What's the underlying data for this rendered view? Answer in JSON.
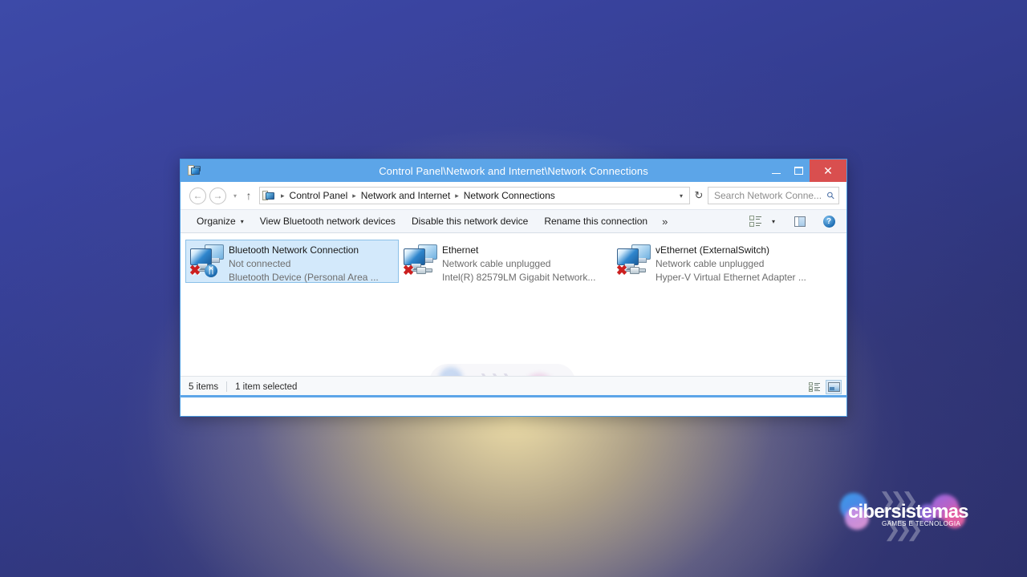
{
  "window": {
    "title": "Control Panel\\Network and Internet\\Network Connections",
    "app_icon": "network-connections-icon",
    "controls": {
      "minimize": "–",
      "maximize": "❑",
      "close": "✕"
    }
  },
  "navbar": {
    "back_icon": "←",
    "forward_icon": "→",
    "recent_caret": "▾",
    "up_icon": "↑",
    "breadcrumb": [
      "Control Panel",
      "Network and Internet",
      "Network Connections"
    ],
    "breadcrumb_separator": "▸",
    "address_caret": "▾",
    "refresh_icon": "↻",
    "search_placeholder": "Search Network Conne...",
    "search_value": "",
    "search_icon": "⚲"
  },
  "toolbar": {
    "organize_label": "Organize",
    "organize_caret": "▾",
    "view_bluetooth_label": "View Bluetooth network devices",
    "disable_device_label": "Disable this network device",
    "rename_connection_label": "Rename this connection",
    "overflow_label": "»",
    "change_view_icon": "change-view-icon",
    "change_view_caret": "▾",
    "preview_pane_icon": "preview-pane-icon",
    "help_icon": "?"
  },
  "connections": [
    {
      "name": "Bluetooth Network Connection",
      "status": "Not connected",
      "device": "Bluetooth Device (Personal Area ...",
      "selected": true,
      "badge": "bluetooth",
      "badge_glyph": "ᛗ",
      "disabled_glyph": "✖"
    },
    {
      "name": "Ethernet",
      "status": "Network cable unplugged",
      "device": "Intel(R) 82579LM Gigabit Network...",
      "selected": false,
      "badge": "rj45-cable",
      "badge_glyph": "",
      "disabled_glyph": "✖"
    },
    {
      "name": "vEthernet (ExternalSwitch)",
      "status": "Network cable unplugged",
      "device": "Hyper-V Virtual Ethernet Adapter ...",
      "selected": false,
      "badge": "rj45-cable",
      "badge_glyph": "",
      "disabled_glyph": "✖"
    }
  ],
  "statusbar": {
    "item_count": "5 items",
    "selection_count": "1 item selected",
    "details_view_icon": "details-view-icon",
    "large_icons_view_icon": "large-icons-view-icon"
  },
  "watermark": {
    "title": "cibersistemas",
    "subtitle": "GAMES E TECNOLOGIA"
  },
  "colors": {
    "titlebar": "#5ca5e8",
    "close_button": "#d94f4f",
    "selection": "#d3e9fb",
    "selection_border": "#8bc0e8",
    "toolbar_bg": "#f3f6fa",
    "desktop_blue": "#333c8e",
    "desktop_glow": "#f3e2a8"
  }
}
